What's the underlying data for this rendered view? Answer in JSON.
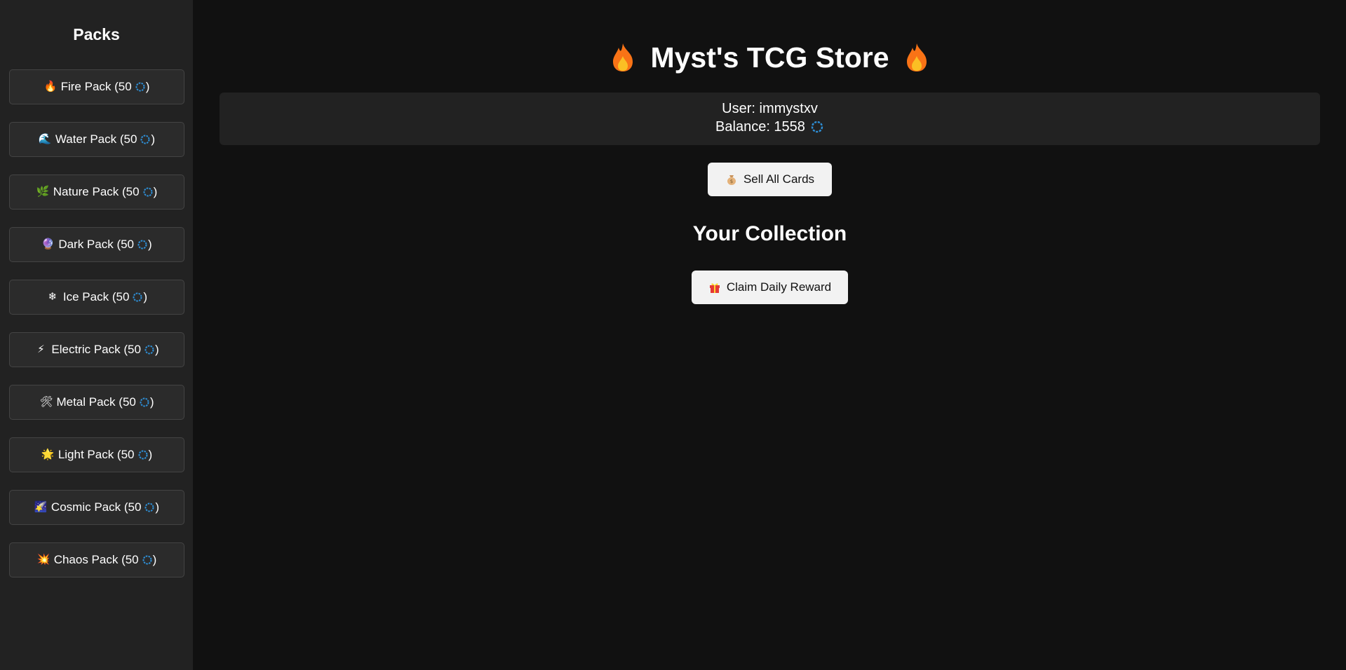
{
  "sidebar": {
    "title": "Packs",
    "packs": [
      {
        "label": "Fire Pack (50 ",
        "close": ")",
        "icon": "fire-icon",
        "emoji": "🔥"
      },
      {
        "label": "Water Pack (50 ",
        "close": ")",
        "icon": "wave-icon",
        "emoji": "🌊"
      },
      {
        "label": "Nature Pack (50 ",
        "close": ")",
        "icon": "herb-icon",
        "emoji": "🌿"
      },
      {
        "label": "Dark Pack (50 ",
        "close": ")",
        "icon": "dark-orb-icon",
        "emoji": "🔮"
      },
      {
        "label": "Ice Pack (50 ",
        "close": ")",
        "icon": "snowflake-icon",
        "emoji": "❄"
      },
      {
        "label": "Electric Pack (50 ",
        "close": ")",
        "icon": "lightning-icon",
        "emoji": "⚡"
      },
      {
        "label": "Metal Pack (50 ",
        "close": ")",
        "icon": "tools-icon",
        "emoji": "🛠"
      },
      {
        "label": "Light Pack (50 ",
        "close": ")",
        "icon": "sun-icon",
        "emoji": "🌟"
      },
      {
        "label": "Cosmic Pack (50 ",
        "close": ")",
        "icon": "comet-icon",
        "emoji": "🌠"
      },
      {
        "label": "Chaos Pack (50 ",
        "close": ")",
        "icon": "explosion-icon",
        "emoji": "💥"
      }
    ]
  },
  "main": {
    "title": "Myst's TCG Store",
    "user_line": "User: immystxv",
    "balance_line": "Balance: 1558",
    "sell_label": "Sell All Cards",
    "collection_title": "Your Collection",
    "claim_label": "Claim Daily Reward"
  },
  "colors": {
    "page_bg": "#111111",
    "sidebar_bg": "#222222",
    "button_light": "#f2f2f2",
    "coin_blue": "#2e8fd6",
    "flame_orange": "#f97316"
  }
}
